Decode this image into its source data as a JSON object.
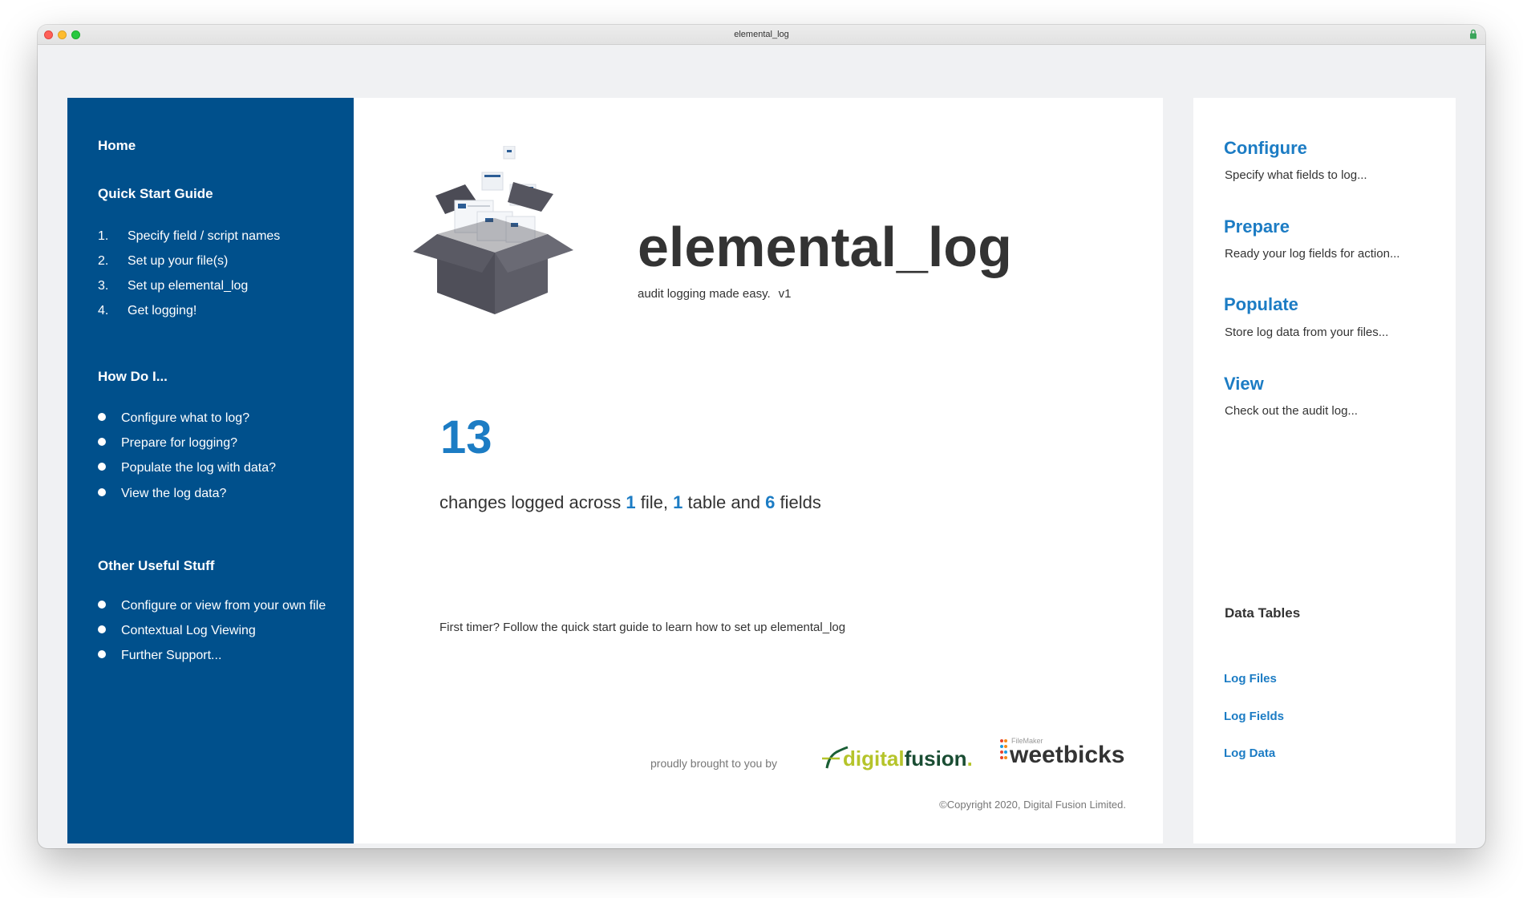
{
  "window": {
    "title": "elemental_log"
  },
  "nav": {
    "home": "Home",
    "quick_start": {
      "heading": "Quick Start Guide",
      "items": [
        {
          "num": "1.",
          "label": "Specify field / script names"
        },
        {
          "num": "2.",
          "label": "Set up your file(s)"
        },
        {
          "num": "3.",
          "label": "Set up elemental_log"
        },
        {
          "num": "4.",
          "label": "Get logging!"
        }
      ]
    },
    "how_do_i": {
      "heading": "How Do I...",
      "items": [
        "Configure what to log?",
        "Prepare for logging?",
        "Populate the log with data?",
        "View the log data?"
      ]
    },
    "other": {
      "heading": "Other Useful Stuff",
      "items": [
        "Configure or view from your own file",
        "Contextual Log Viewing",
        "Further Support..."
      ]
    }
  },
  "main": {
    "app_title": "elemental_log",
    "tagline": "audit logging made easy.",
    "version": "v1",
    "change_count": "13",
    "summary": {
      "prefix": "changes logged across",
      "files_count": "1",
      "files_word": "file,",
      "tables_count": "1",
      "tables_word": "table and",
      "fields_count": "6",
      "fields_word": "fields"
    },
    "first_timer": "First timer? Follow the quick start guide to learn how to set up elemental_log",
    "brought_by": "proudly brought to you by",
    "logos": {
      "digitalfusion": {
        "part1": "digital",
        "part2": "fusion",
        "part3": "."
      },
      "weetbicks": {
        "small": "FileMaker",
        "name": "weetbicks"
      }
    },
    "copyright": "©Copyright 2020, Digital Fusion Limited."
  },
  "right": {
    "sections": [
      {
        "title": "Configure",
        "desc": "Specify what fields to log..."
      },
      {
        "title": "Prepare",
        "desc": "Ready your log fields for action..."
      },
      {
        "title": "Populate",
        "desc": "Store log data from your files..."
      },
      {
        "title": "View",
        "desc": "Check out the audit log..."
      }
    ],
    "data_tables": {
      "heading": "Data Tables",
      "links": [
        "Log Files",
        "Log Fields",
        "Log Data"
      ]
    }
  },
  "colors": {
    "nav_bg": "#00508c",
    "accent": "#1c7cc4",
    "text": "#333333",
    "window_bg": "#f0f1f3"
  }
}
